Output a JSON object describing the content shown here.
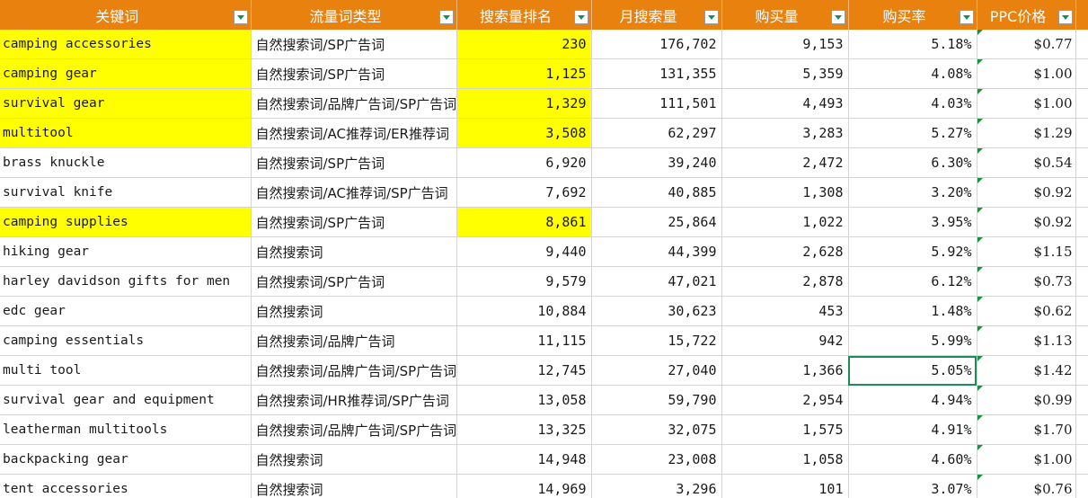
{
  "headers": [
    "关键词",
    "流量词类型",
    "搜索量排名",
    "月搜索量",
    "购买量",
    "购买率",
    "PPC价格"
  ],
  "colors": {
    "header_bg": "#E8810E",
    "highlight": "#FFFF00",
    "grid": "#d4d4d4",
    "selection": "#1d8a5a"
  },
  "rows": [
    {
      "keyword": "camping accessories",
      "type": "自然搜索词/SP广告词",
      "rank": "230",
      "monthly": "176,702",
      "purchases": "9,153",
      "rate": "5.18%",
      "ppc": "$0.77",
      "hl_kw": true,
      "hl_rank": true
    },
    {
      "keyword": "camping gear",
      "type": "自然搜索词/SP广告词",
      "rank": "1,125",
      "monthly": "131,355",
      "purchases": "5,359",
      "rate": "4.08%",
      "ppc": "$1.00",
      "hl_kw": true,
      "hl_rank": true
    },
    {
      "keyword": "survival gear",
      "type": "自然搜索词/品牌广告词/SP广告词",
      "rank": "1,329",
      "monthly": "111,501",
      "purchases": "4,493",
      "rate": "4.03%",
      "ppc": "$1.00",
      "hl_kw": true,
      "hl_rank": true
    },
    {
      "keyword": "multitool",
      "type": "自然搜索词/AC推荐词/ER推荐词",
      "rank": "3,508",
      "monthly": "62,297",
      "purchases": "3,283",
      "rate": "5.27%",
      "ppc": "$1.29",
      "hl_kw": true,
      "hl_rank": true
    },
    {
      "keyword": "brass knuckle",
      "type": "自然搜索词/SP广告词",
      "rank": "6,920",
      "monthly": "39,240",
      "purchases": "2,472",
      "rate": "6.30%",
      "ppc": "$0.54",
      "hl_kw": false,
      "hl_rank": false
    },
    {
      "keyword": "survival knife",
      "type": "自然搜索词/AC推荐词/SP广告词",
      "rank": "7,692",
      "monthly": "40,885",
      "purchases": "1,308",
      "rate": "3.20%",
      "ppc": "$0.92",
      "hl_kw": false,
      "hl_rank": false
    },
    {
      "keyword": "camping supplies",
      "type": "自然搜索词/SP广告词",
      "rank": "8,861",
      "monthly": "25,864",
      "purchases": "1,022",
      "rate": "3.95%",
      "ppc": "$0.92",
      "hl_kw": true,
      "hl_rank": true
    },
    {
      "keyword": "hiking gear",
      "type": "自然搜索词",
      "rank": "9,440",
      "monthly": "44,399",
      "purchases": "2,628",
      "rate": "5.92%",
      "ppc": "$1.15",
      "hl_kw": false,
      "hl_rank": false
    },
    {
      "keyword": "harley davidson gifts for men",
      "type": "自然搜索词/SP广告词",
      "rank": "9,579",
      "monthly": "47,021",
      "purchases": "2,878",
      "rate": "6.12%",
      "ppc": "$0.73",
      "hl_kw": false,
      "hl_rank": false
    },
    {
      "keyword": "edc gear",
      "type": "自然搜索词",
      "rank": "10,884",
      "monthly": "30,623",
      "purchases": "453",
      "rate": "1.48%",
      "ppc": "$0.62",
      "hl_kw": false,
      "hl_rank": false
    },
    {
      "keyword": "camping essentials",
      "type": "自然搜索词/品牌广告词",
      "rank": "11,115",
      "monthly": "15,722",
      "purchases": "942",
      "rate": "5.99%",
      "ppc": "$1.13",
      "hl_kw": false,
      "hl_rank": false
    },
    {
      "keyword": "multi tool",
      "type": "自然搜索词/品牌广告词/SP广告词",
      "rank": "12,745",
      "monthly": "27,040",
      "purchases": "1,366",
      "rate": "5.05%",
      "ppc": "$1.42",
      "hl_kw": false,
      "hl_rank": false
    },
    {
      "keyword": "survival gear and equipment",
      "type": "自然搜索词/HR推荐词/SP广告词",
      "rank": "13,058",
      "monthly": "59,790",
      "purchases": "2,954",
      "rate": "4.94%",
      "ppc": "$0.99",
      "hl_kw": false,
      "hl_rank": false
    },
    {
      "keyword": "leatherman multitools",
      "type": "自然搜索词/品牌广告词/SP广告词",
      "rank": "13,325",
      "monthly": "32,075",
      "purchases": "1,575",
      "rate": "4.91%",
      "ppc": "$1.70",
      "hl_kw": false,
      "hl_rank": false
    },
    {
      "keyword": "backpacking gear",
      "type": "自然搜索词",
      "rank": "14,948",
      "monthly": "23,008",
      "purchases": "1,058",
      "rate": "4.60%",
      "ppc": "$1.00",
      "hl_kw": false,
      "hl_rank": false
    },
    {
      "keyword": "tent accessories",
      "type": "自然搜索词",
      "rank": "14,969",
      "monthly": "3,296",
      "purchases": "101",
      "rate": "3.07%",
      "ppc": "$0.76",
      "hl_kw": false,
      "hl_rank": false
    }
  ],
  "selected_row": 11
}
